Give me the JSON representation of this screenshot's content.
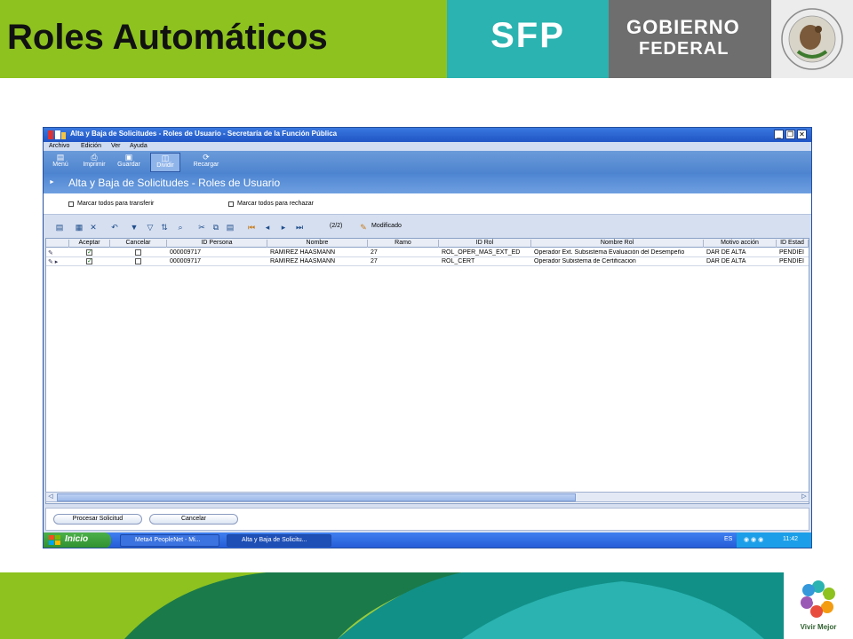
{
  "slide": {
    "title": "Roles Automáticos",
    "sfp_logo": "SFP",
    "gobierno_line1": "GOBIERNO",
    "gobierno_line2": "FEDERAL",
    "vivir_mejor": "Vivir Mejor",
    "colors": {
      "green": "#8dc21f",
      "teal": "#2ab3b0",
      "gray": "#6e6e6e"
    }
  },
  "window": {
    "title": "Alta y Baja de Solicitudes - Roles de Usuario - Secretaría de la Función Pública",
    "menu": [
      "Archivo",
      "Edición",
      "Ver",
      "Ayuda"
    ],
    "toolbar": [
      {
        "label": "Menú",
        "icon": "menu-icon"
      },
      {
        "label": "Imprimir",
        "icon": "print-icon"
      },
      {
        "label": "Guardar",
        "icon": "save-icon"
      },
      {
        "label": "Dividir",
        "icon": "split-icon"
      },
      {
        "label": "Recargar",
        "icon": "reload-icon"
      }
    ],
    "banner_title": "Alta y Baja de Solicitudes - Roles de Usuario",
    "check_transfer": "Marcar todos para transferir",
    "check_reject": "Marcar todos para rechazar",
    "pager": "(2/2)",
    "modified": "Modificado"
  },
  "grid": {
    "columns": [
      "Aceptar",
      "Cancelar",
      "ID Persona",
      "Nombre",
      "Ramo",
      "ID Rol",
      "Nombre Rol",
      "Motivo acción",
      "ID Estad"
    ],
    "rows": [
      {
        "aceptar": true,
        "cancelar": false,
        "id_persona": "000009717",
        "nombre": "RAMIREZ HAASMANN",
        "ramo": "27",
        "id_rol": "ROL_OPER_MAS_EXT_ED",
        "nombre_rol": "Operador Ext. Subsistema Evaluación del Desempeño",
        "motivo": "DAR DE ALTA",
        "estado": "PENDIEI"
      },
      {
        "aceptar": true,
        "cancelar": false,
        "id_persona": "000009717",
        "nombre": "RAMIREZ HAASMANN",
        "ramo": "27",
        "id_rol": "ROL_CERT",
        "nombre_rol": "Operador Subistema de Certificacion",
        "motivo": "DAR DE ALTA",
        "estado": "PENDIEI"
      }
    ]
  },
  "actions": {
    "process": "Procesar Solicitud",
    "cancel": "Cancelar"
  },
  "taskbar": {
    "start": "Inicio",
    "tasks": [
      "Meta4 PeopleNet - Mi...",
      "Alta y Baja de Solicitu..."
    ],
    "lang": "ES",
    "clock": "11:42"
  }
}
